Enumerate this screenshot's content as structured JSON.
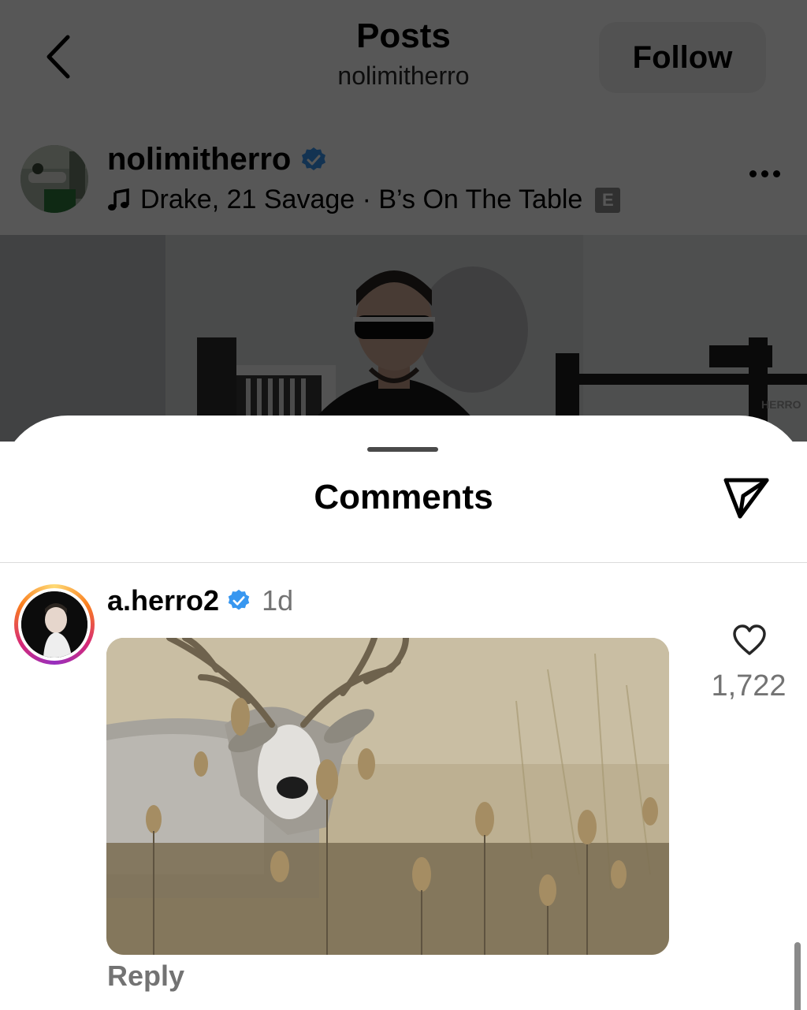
{
  "header": {
    "title": "Posts",
    "subtitle": "nolimitherro",
    "follow_label": "Follow"
  },
  "post": {
    "username": "nolimitherro",
    "music": "Drake, 21 Savage · B’s On The Table",
    "explicit_badge": "E",
    "image_text": "HERRO"
  },
  "comments_sheet": {
    "title": "Comments",
    "comment": {
      "username": "a.herro2",
      "time": "1d",
      "likes": "1,722",
      "reply_label": "Reply"
    }
  },
  "colors": {
    "verified": "#3897f0",
    "overlay": "rgba(0,0,0,0.66)",
    "muted_text": "#737373"
  }
}
